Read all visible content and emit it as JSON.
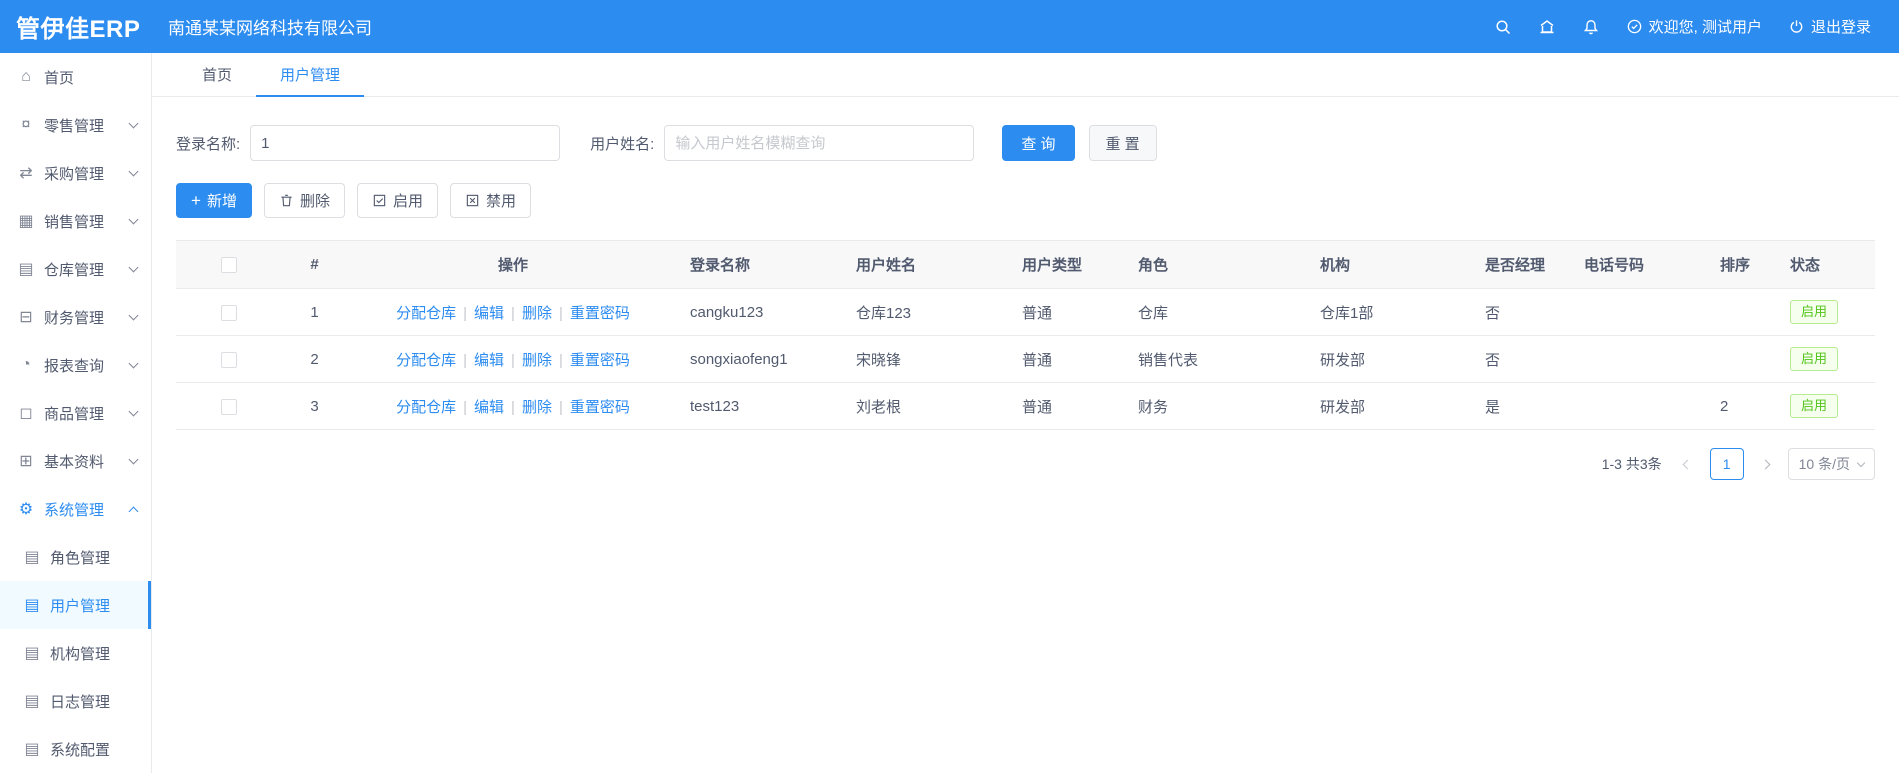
{
  "header": {
    "logo": "管伊佳ERP",
    "company": "南通某某网络科技有限公司",
    "welcome": "欢迎您, 测试用户",
    "logout": "退出登录"
  },
  "tabs": [
    {
      "label": "首页",
      "active": false
    },
    {
      "label": "用户管理",
      "active": true
    }
  ],
  "sidebar": {
    "items": [
      {
        "id": "home",
        "label": "首页",
        "icon": "home",
        "sub": false,
        "chevron": null,
        "open": false,
        "active": false
      },
      {
        "id": "retail",
        "label": "零售管理",
        "icon": "retail",
        "sub": false,
        "chevron": "down",
        "open": false,
        "active": false
      },
      {
        "id": "purchase",
        "label": "采购管理",
        "icon": "purchase",
        "sub": false,
        "chevron": "down",
        "open": false,
        "active": false
      },
      {
        "id": "sales",
        "label": "销售管理",
        "icon": "sales",
        "sub": false,
        "chevron": "down",
        "open": false,
        "active": false
      },
      {
        "id": "warehouse",
        "label": "仓库管理",
        "icon": "warehouse",
        "sub": false,
        "chevron": "down",
        "open": false,
        "active": false
      },
      {
        "id": "finance",
        "label": "财务管理",
        "icon": "finance",
        "sub": false,
        "chevron": "down",
        "open": false,
        "active": false
      },
      {
        "id": "report",
        "label": "报表查询",
        "icon": "report",
        "sub": false,
        "chevron": "down",
        "open": false,
        "active": false
      },
      {
        "id": "product",
        "label": "商品管理",
        "icon": "product",
        "sub": false,
        "chevron": "down",
        "open": false,
        "active": false
      },
      {
        "id": "basic",
        "label": "基本资料",
        "icon": "basic",
        "sub": false,
        "chevron": "down",
        "open": false,
        "active": false
      },
      {
        "id": "system",
        "label": "系统管理",
        "icon": "system",
        "sub": false,
        "chevron": "up",
        "open": true,
        "active": false
      },
      {
        "id": "role",
        "label": "角色管理",
        "icon": "doc",
        "sub": true,
        "chevron": null,
        "open": false,
        "active": false
      },
      {
        "id": "user",
        "label": "用户管理",
        "icon": "doc",
        "sub": true,
        "chevron": null,
        "open": false,
        "active": true
      },
      {
        "id": "org",
        "label": "机构管理",
        "icon": "doc",
        "sub": true,
        "chevron": null,
        "open": false,
        "active": false
      },
      {
        "id": "log",
        "label": "日志管理",
        "icon": "doc",
        "sub": true,
        "chevron": null,
        "open": false,
        "active": false
      },
      {
        "id": "config",
        "label": "系统配置",
        "icon": "doc",
        "sub": true,
        "chevron": null,
        "open": false,
        "active": false
      }
    ]
  },
  "filter": {
    "login_label": "登录名称:",
    "login_value": "1",
    "name_label": "用户姓名:",
    "name_placeholder": "输入用户姓名模糊查询",
    "search_label": "查 询",
    "reset_label": "重 置"
  },
  "toolbar": {
    "add_label": "新增",
    "delete_label": "删除",
    "enable_label": "启用",
    "disable_label": "禁用"
  },
  "table": {
    "headers": [
      "#",
      "操作",
      "登录名称",
      "用户姓名",
      "用户类型",
      "角色",
      "机构",
      "是否经理",
      "电话号码",
      "排序",
      "状态"
    ],
    "op_links": [
      "分配仓库",
      "编辑",
      "删除",
      "重置密码"
    ],
    "rows": [
      {
        "num": "1",
        "login": "cangku123",
        "name": "仓库123",
        "type": "普通",
        "role": "仓库",
        "org": "仓库1部",
        "manager": "否",
        "phone": "",
        "sort": "",
        "status": "启用"
      },
      {
        "num": "2",
        "login": "songxiaofeng1",
        "name": "宋晓锋",
        "type": "普通",
        "role": "销售代表",
        "org": "研发部",
        "manager": "否",
        "phone": "",
        "sort": "",
        "status": "启用"
      },
      {
        "num": "3",
        "login": "test123",
        "name": "刘老根",
        "type": "普通",
        "role": "财务",
        "org": "研发部",
        "manager": "是",
        "phone": "",
        "sort": "2",
        "status": "启用"
      }
    ]
  },
  "pagination": {
    "total_text": "1-3 共3条",
    "current_page": "1",
    "page_size": "10 条/页"
  },
  "colors": {
    "primary": "#2d8cf0",
    "success": "#52c41a"
  }
}
